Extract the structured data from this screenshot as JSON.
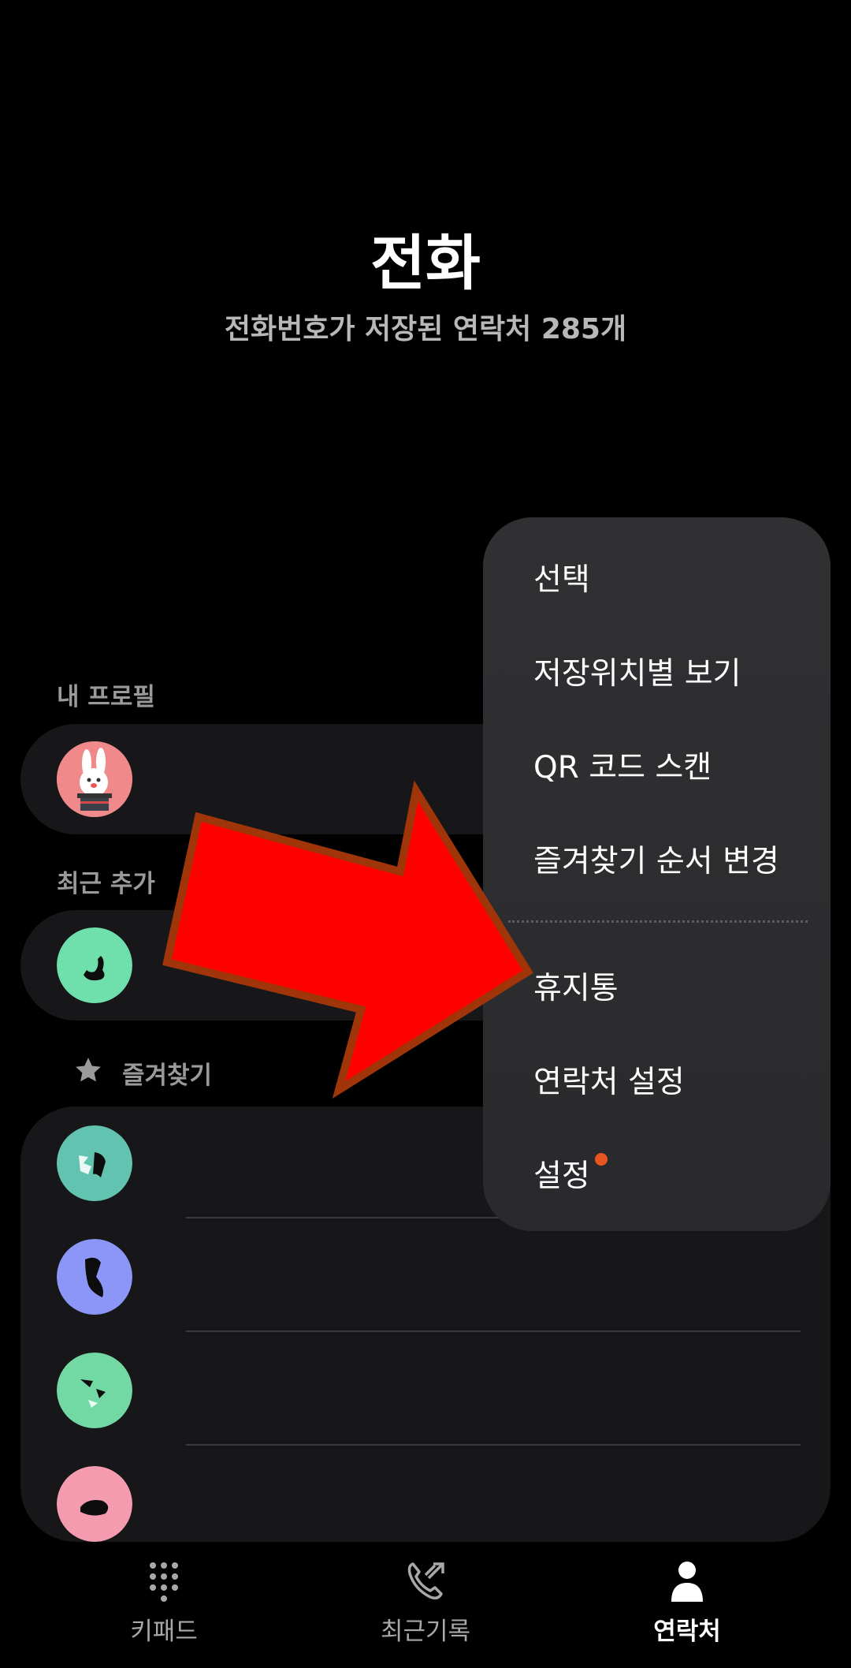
{
  "header": {
    "title": "전화",
    "subtitle": "전화번호가 저장된 연락처 285개"
  },
  "sections": {
    "my_profile": "내 프로필",
    "recent_added": "최근 추가",
    "favorites": "즐겨찾기"
  },
  "icons": {
    "favorites": "star-icon",
    "keypad": "keypad-icon",
    "recents": "call-log-icon",
    "contacts": "person-icon"
  },
  "menu": {
    "items": [
      "선택",
      "저장위치별 보기",
      "QR 코드 스캔",
      "즐겨찾기 순서 변경",
      "휴지통",
      "연락처 설정",
      "설정"
    ],
    "badge_color": "#e8561f"
  },
  "nav": {
    "keypad": "키패드",
    "recents": "최근기록",
    "contacts": "연락처"
  },
  "colors": {
    "background": "#000000",
    "card": "#17171a",
    "menu": "#2e2e31",
    "arrow_fill": "#ff0000",
    "arrow_stroke": "#a0350a"
  }
}
